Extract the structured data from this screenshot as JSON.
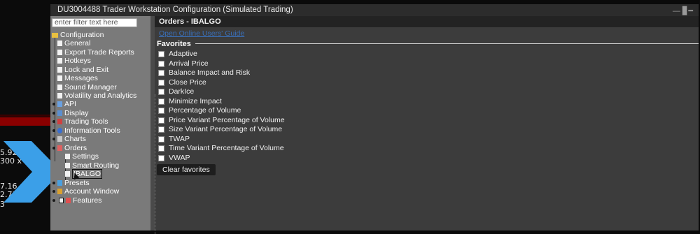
{
  "background": {
    "numbers": [
      "5.92",
      "300 x",
      "7.16 -",
      "2.73",
      "3"
    ]
  },
  "window": {
    "title": "DU3004488 Trader Workstation Configuration (Simulated Trading)",
    "controls": "— ▊━"
  },
  "filter": {
    "placeholder": "enter filter text here"
  },
  "tree": {
    "root": "Configuration",
    "general": "General",
    "export": "Export Trade Reports",
    "hotkeys": "Hotkeys",
    "lockexit": "Lock and Exit",
    "messages": "Messages",
    "sound": "Sound Manager",
    "volatility": "Volatility and Analytics",
    "api": "API",
    "display": "Display",
    "trading_tools": "Trading Tools",
    "info_tools": "Information Tools",
    "charts": "Charts",
    "orders": "Orders",
    "settings": "Settings",
    "smart_routing": "Smart Routing",
    "ibalgo": "IBALGO",
    "presets": "Presets",
    "account_window": "Account Window",
    "features": "Features"
  },
  "panel": {
    "title": "Orders - IBALGO",
    "guide_link": "Open Online Users' Guide",
    "favorites_label": "Favorites",
    "items": [
      "Adaptive",
      "Arrival Price",
      "Balance Impact and Risk",
      "Close Price",
      "DarkIce",
      "Minimize Impact",
      "Percentage of Volume",
      "Price Variant Percentage of Volume",
      "Size Variant Percentage of Volume",
      "TWAP",
      "Time Variant Percentage of Volume",
      "VWAP"
    ],
    "clear_button": "Clear favorites"
  },
  "colors": {
    "accent_arrow": "#3b9fe8",
    "link": "#3a6fb8",
    "panel_bg": "#3c3c3c",
    "tree_bg": "#7a7a7a"
  }
}
